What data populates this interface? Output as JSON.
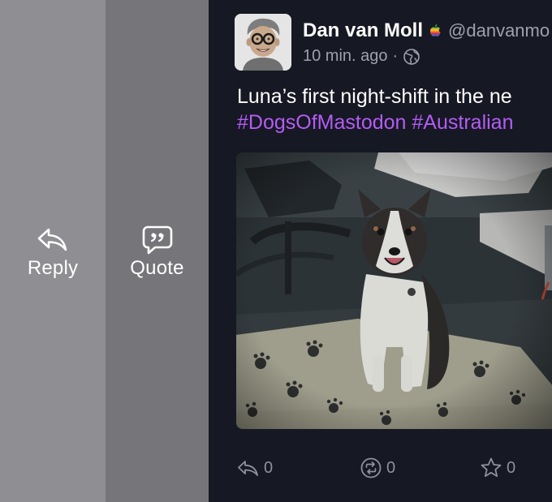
{
  "swipe_actions": {
    "reply": {
      "label": "Reply",
      "icon": "reply-icon"
    },
    "quote": {
      "label": "Quote",
      "icon": "quote-icon"
    }
  },
  "post": {
    "author": {
      "display_name": "Dan van Moll",
      "handle": "@danvanmo",
      "badge_icon": "apple-logo-icon"
    },
    "meta": {
      "time": "10 min. ago",
      "separator": "·",
      "visibility_icon": "globe-icon"
    },
    "content": {
      "text": "Luna’s first night-shift in the ne",
      "hashtags": [
        "#DogsOfMastodon",
        "#Australian"
      ]
    },
    "media": {
      "subject": "dog-photo"
    },
    "toolbar": {
      "replies": "0",
      "boosts": "0",
      "favourites": "0"
    }
  },
  "colors": {
    "background": "#161823",
    "reply_action": "#8e8e93",
    "quote_action": "#76767a",
    "hashtag": "#b45cf5",
    "secondary_text": "#9ea0ab"
  }
}
